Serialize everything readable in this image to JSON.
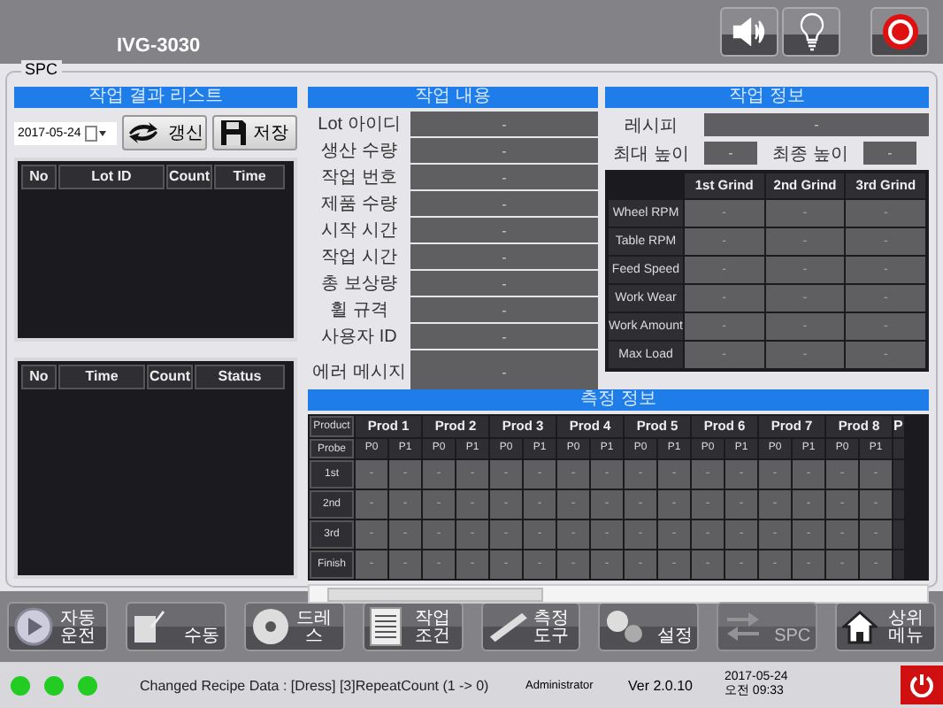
{
  "header": {
    "title": "IVG-3030"
  },
  "group_title": "SPC",
  "result_list": {
    "title": "작업 결과 리스트",
    "date": "2017-05-24",
    "refresh_button": "갱신",
    "save_button": "저장",
    "lot_columns": [
      "No",
      "Lot ID",
      "Count",
      "Time"
    ],
    "status_columns": [
      "No",
      "Time",
      "Count",
      "Status"
    ]
  },
  "work_content": {
    "title": "작업 내용",
    "fields": [
      {
        "label": "Lot 아이디",
        "value": "-"
      },
      {
        "label": "생산 수량",
        "value": "-"
      },
      {
        "label": "작업 번호",
        "value": "-"
      },
      {
        "label": "제품 수량",
        "value": "-"
      },
      {
        "label": "시작 시간",
        "value": "-"
      },
      {
        "label": "작업 시간",
        "value": "-"
      },
      {
        "label": "총 보상량",
        "value": "-"
      },
      {
        "label": "휠 규격",
        "value": "-"
      },
      {
        "label": "사용자 ID",
        "value": "-"
      },
      {
        "label": "에러 메시지",
        "value": "-",
        "kind": "tall"
      }
    ]
  },
  "work_info": {
    "title": "작업 정보",
    "recipe_label": "레시피",
    "recipe_value": "-",
    "max_height_label": "최대 높이",
    "max_height_value": "-",
    "final_height_label": "최종 높이",
    "final_height_value": "-",
    "columns": [
      "1st Grind",
      "2nd Grind",
      "3rd Grind"
    ],
    "rows": [
      {
        "label": "Wheel RPM",
        "values": [
          "-",
          "-",
          "-"
        ]
      },
      {
        "label": "Table RPM",
        "values": [
          "-",
          "-",
          "-"
        ]
      },
      {
        "label": "Feed Speed",
        "values": [
          "-",
          "-",
          "-"
        ]
      },
      {
        "label": "Work Wear",
        "values": [
          "-",
          "-",
          "-"
        ]
      },
      {
        "label": "Work Amount",
        "values": [
          "-",
          "-",
          "-"
        ]
      },
      {
        "label": "Max Load",
        "values": [
          "-",
          "-",
          "-"
        ]
      }
    ]
  },
  "measurement": {
    "title": "측정 정보",
    "product_label": "Product",
    "probe_label": "Probe",
    "products": [
      {
        "label": "Prod 1",
        "probes": [
          "P0",
          "P1"
        ]
      },
      {
        "label": "Prod 2",
        "probes": [
          "P0",
          "P1"
        ]
      },
      {
        "label": "Prod 3",
        "probes": [
          "P0",
          "P1"
        ]
      },
      {
        "label": "Prod 4",
        "probes": [
          "P0",
          "P1"
        ]
      },
      {
        "label": "Prod 5",
        "probes": [
          "P0",
          "P1"
        ]
      },
      {
        "label": "Prod 6",
        "probes": [
          "P0",
          "P1"
        ]
      },
      {
        "label": "Prod 7",
        "probes": [
          "P0",
          "P1"
        ]
      },
      {
        "label": "Prod 8",
        "probes": [
          "P0",
          "P1"
        ]
      }
    ],
    "cut_product": "P",
    "rows": [
      {
        "label": "1st",
        "values": [
          "-",
          "-",
          "-",
          "-",
          "-",
          "-",
          "-",
          "-",
          "-",
          "-",
          "-",
          "-",
          "-",
          "-",
          "-",
          "-"
        ]
      },
      {
        "label": "2nd",
        "values": [
          "-",
          "-",
          "-",
          "-",
          "-",
          "-",
          "-",
          "-",
          "-",
          "-",
          "-",
          "-",
          "-",
          "-",
          "-",
          "-"
        ]
      },
      {
        "label": "3rd",
        "values": [
          "-",
          "-",
          "-",
          "-",
          "-",
          "-",
          "-",
          "-",
          "-",
          "-",
          "-",
          "-",
          "-",
          "-",
          "-",
          "-"
        ]
      },
      {
        "label": "Finish",
        "values": [
          "-",
          "-",
          "-",
          "-",
          "-",
          "-",
          "-",
          "-",
          "-",
          "-",
          "-",
          "-",
          "-",
          "-",
          "-",
          "-"
        ]
      }
    ]
  },
  "nav": [
    {
      "label": "자동운전",
      "kind": "play",
      "selected": false
    },
    {
      "label": "수동",
      "kind": "note",
      "selected": false
    },
    {
      "label": "드레스",
      "kind": "disc",
      "selected": false
    },
    {
      "label": "작업조건",
      "kind": "list",
      "selected": false
    },
    {
      "label": "측정도구",
      "kind": "ruler",
      "selected": false
    },
    {
      "label": "설정",
      "kind": "gears",
      "selected": false
    },
    {
      "label": "SPC",
      "kind": "arrows",
      "selected": true
    },
    {
      "label": "상위 메뉴",
      "kind": "home",
      "selected": false
    }
  ],
  "status_bar": {
    "lamps": [
      {
        "color": "#22cc22"
      },
      {
        "color": "#22cc22"
      },
      {
        "color": "#22cc22"
      }
    ],
    "message": "Changed Recipe Data : [Dress] [3]RepeatCount (1 -> 0)",
    "user": "Administrator",
    "version": "Ver 2.0.10",
    "date": "2017-05-24",
    "time": "오전 09:33"
  }
}
